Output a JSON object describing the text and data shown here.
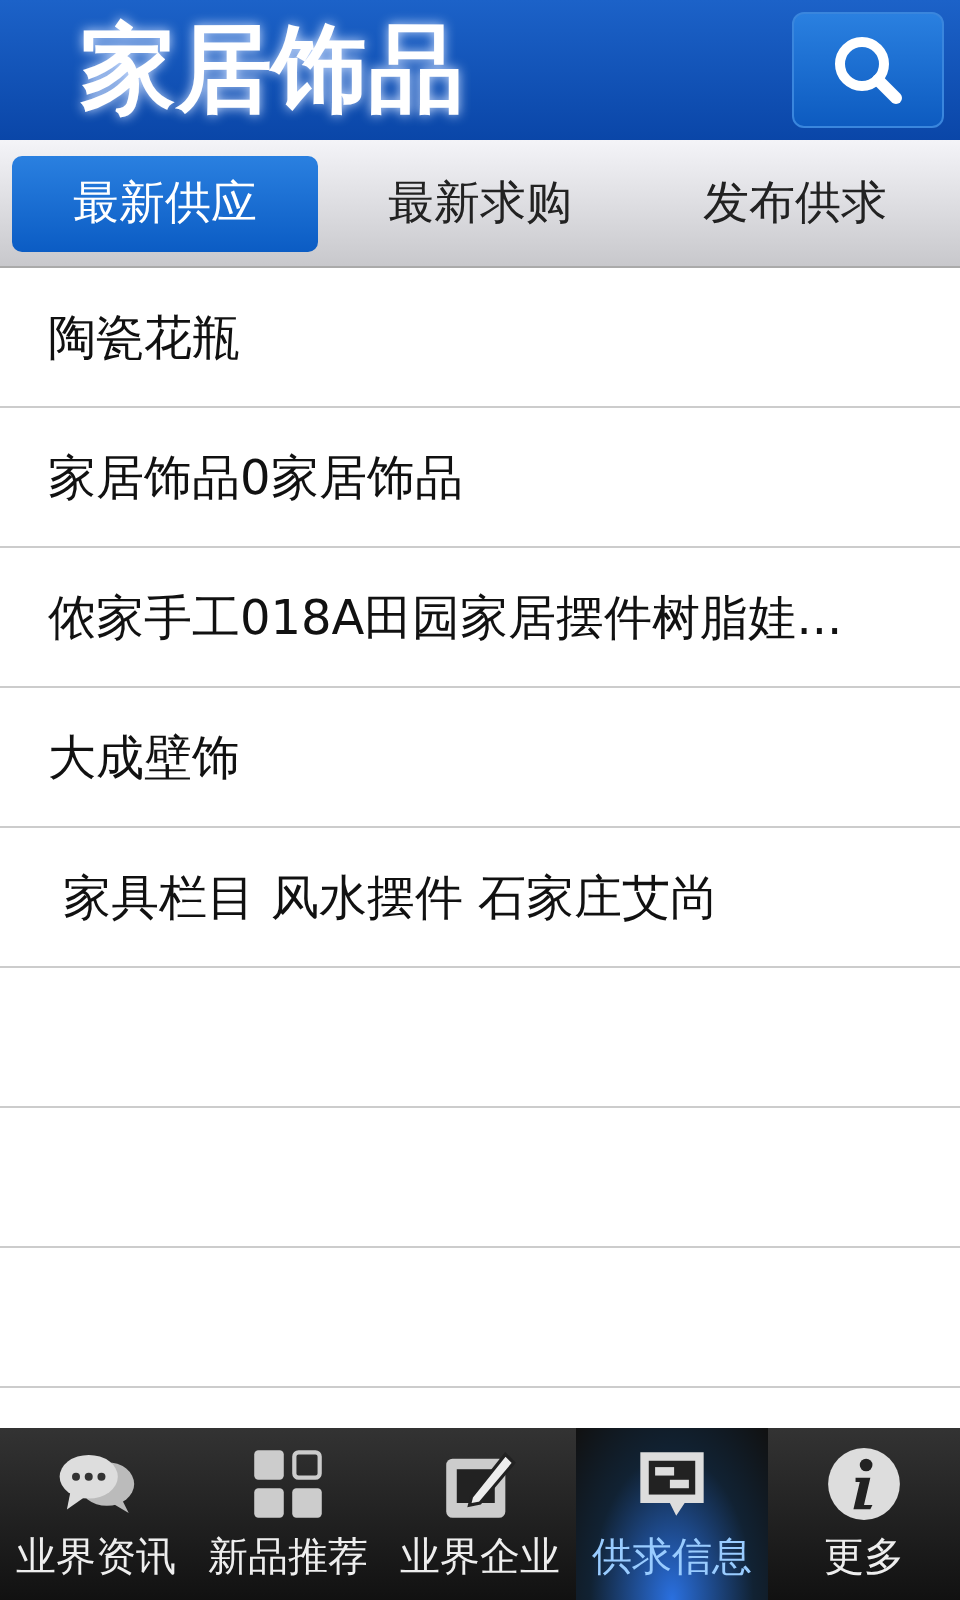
{
  "header": {
    "title": "家居饰品"
  },
  "tabs": [
    {
      "label": "最新供应",
      "selected": true
    },
    {
      "label": "最新求购",
      "selected": false
    },
    {
      "label": "发布供求",
      "selected": false
    }
  ],
  "list": [
    "陶瓷花瓶",
    "家居饰品0家居饰品",
    "侬家手工018A田园家居摆件树脂娃...",
    "大成壁饰",
    " 家具栏目 风水摆件 石家庄艾尚"
  ],
  "nav": [
    {
      "label": "业界资讯",
      "kind": "chat",
      "selected": false
    },
    {
      "label": "新品推荐",
      "kind": "grid",
      "selected": false
    },
    {
      "label": "业界企业",
      "kind": "edit",
      "selected": false
    },
    {
      "label": "供求信息",
      "kind": "message",
      "selected": true
    },
    {
      "label": "更多",
      "kind": "info",
      "selected": false
    }
  ]
}
